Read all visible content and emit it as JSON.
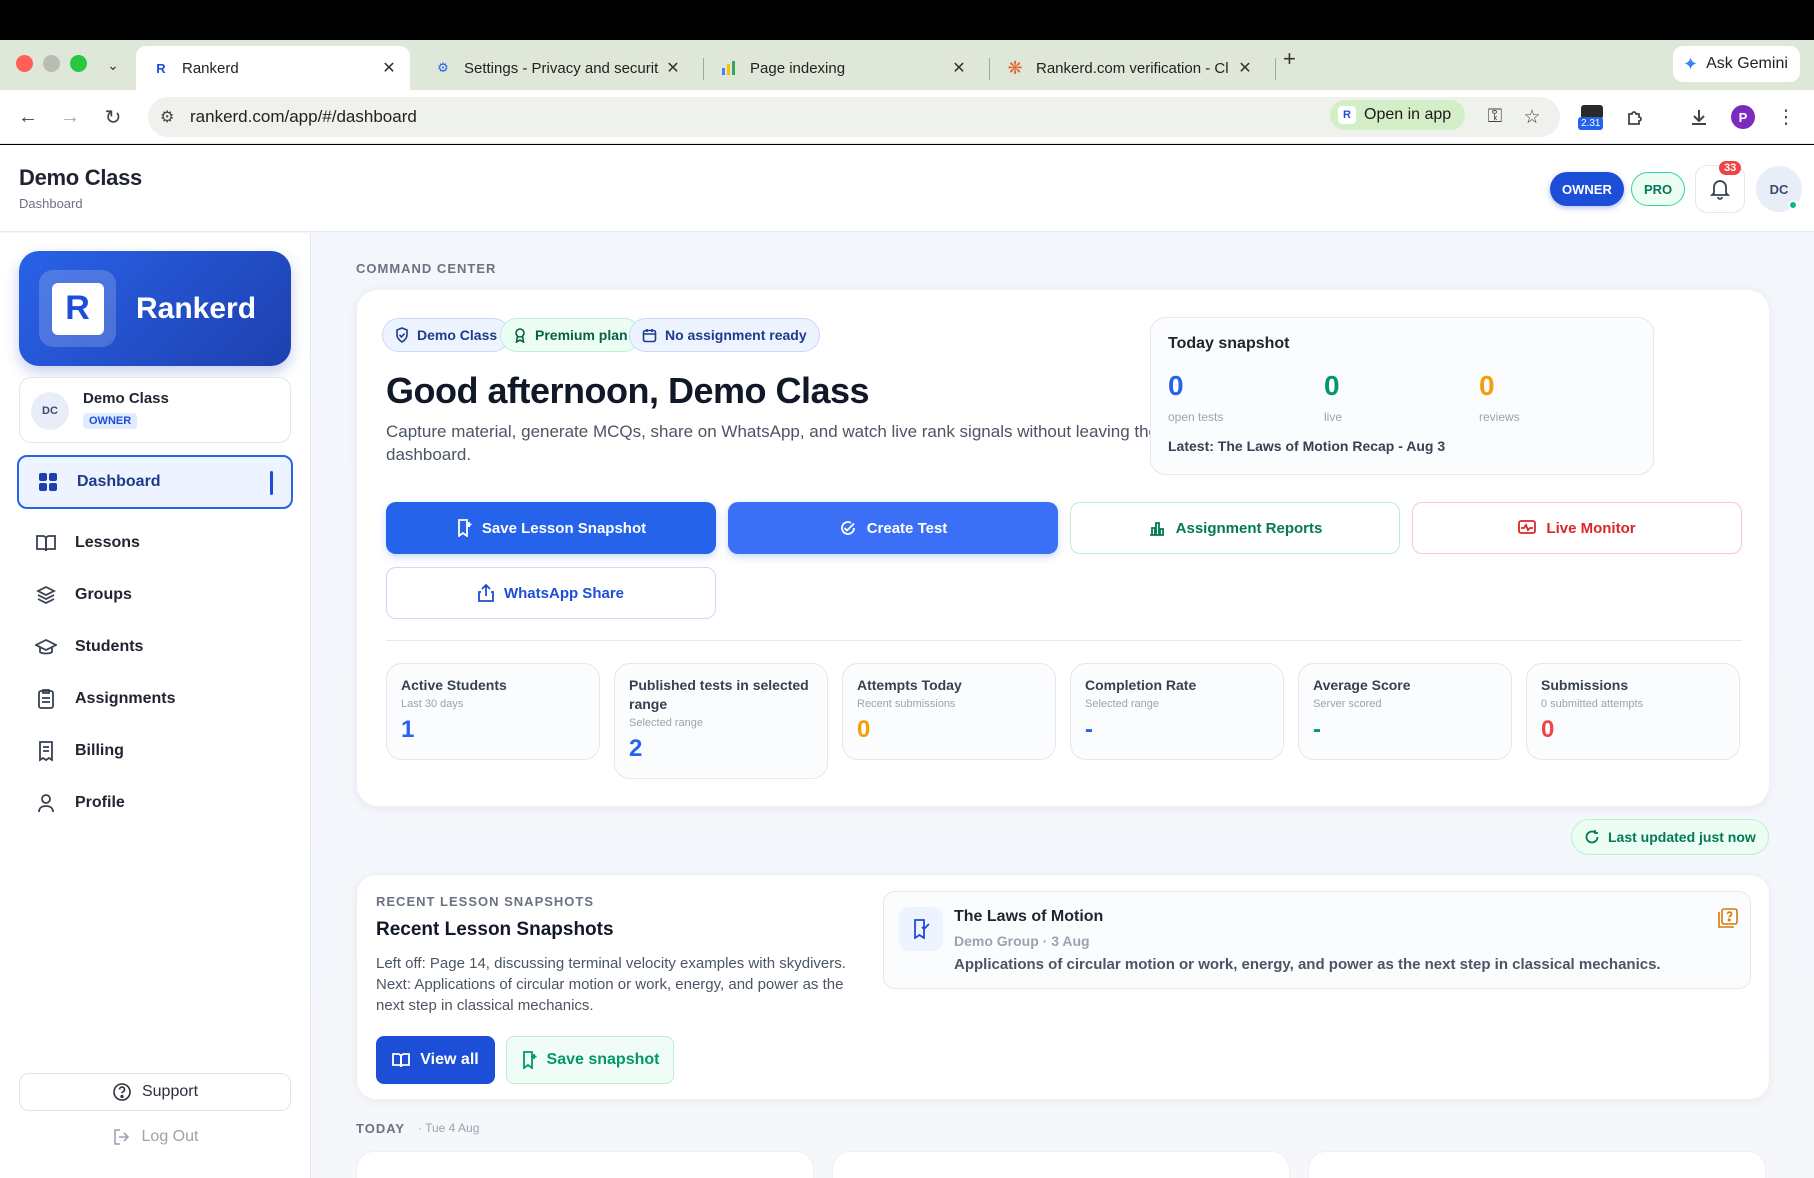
{
  "browser": {
    "tabs": [
      {
        "title": "Rankerd",
        "favicon": "rankerd-logo",
        "active": true
      },
      {
        "title": "Settings - Privacy and securit",
        "favicon": "gear-icon",
        "active": false
      },
      {
        "title": "Page indexing",
        "favicon": "search-console-icon",
        "active": false
      },
      {
        "title": "Rankerd.com verification - Cl",
        "favicon": "claude-icon",
        "active": false
      }
    ],
    "ask_gemini": "Ask Gemini",
    "url": "rankerd.com/app/#/dashboard",
    "open_in_app": "Open in app",
    "extension_badge": "2.31",
    "profile_initial": "P"
  },
  "header": {
    "title": "Demo Class",
    "subtitle": "Dashboard",
    "owner_pill": "OWNER",
    "pro_pill": "PRO",
    "notification_count": "33",
    "avatar_initials": "DC"
  },
  "sidebar": {
    "brand": "Rankerd",
    "brand_mark": "R",
    "org": {
      "initials": "DC",
      "name": "Demo Class",
      "role": "OWNER"
    },
    "items": [
      {
        "label": "Dashboard",
        "icon": "grid-icon",
        "active": true
      },
      {
        "label": "Lessons",
        "icon": "book-icon"
      },
      {
        "label": "Groups",
        "icon": "layers-icon"
      },
      {
        "label": "Students",
        "icon": "graduation-cap-icon"
      },
      {
        "label": "Assignments",
        "icon": "clipboard-icon"
      },
      {
        "label": "Billing",
        "icon": "receipt-icon"
      },
      {
        "label": "Profile",
        "icon": "user-icon"
      }
    ],
    "support": "Support",
    "logout": "Log Out"
  },
  "command_center": {
    "eyebrow": "COMMAND CENTER",
    "chips": [
      {
        "label": "Demo Class",
        "icon": "shield-check-icon",
        "tone": "blue"
      },
      {
        "label": "Premium plan",
        "icon": "award-icon",
        "tone": "green"
      },
      {
        "label": "No assignment ready",
        "icon": "calendar-icon",
        "tone": "blue"
      }
    ],
    "greeting": "Good afternoon, Demo Class",
    "description": "Capture material, generate MCQs, share on WhatsApp, and watch live rank signals without leaving the dashboard.",
    "snapshot": {
      "title": "Today snapshot",
      "metrics": [
        {
          "value": "0",
          "label": "open tests",
          "color": "#2563eb"
        },
        {
          "value": "0",
          "label": "live",
          "color": "#059669"
        },
        {
          "value": "0",
          "label": "reviews",
          "color": "#f59e0b"
        }
      ],
      "latest": "Latest: The Laws of Motion Recap - Aug 3"
    },
    "actions": [
      {
        "label": "Save Lesson Snapshot",
        "style": "solid"
      },
      {
        "label": "Create Test",
        "style": "solid2"
      },
      {
        "label": "Assignment Reports",
        "style": "green"
      },
      {
        "label": "Live Monitor",
        "style": "red"
      },
      {
        "label": "WhatsApp Share",
        "style": "blueout"
      }
    ],
    "stats": [
      {
        "label": "Active Students",
        "sub": "Last 30 days",
        "value": "1",
        "color": "#2563eb"
      },
      {
        "label": "Published tests in selected range",
        "sub": "Selected range",
        "value": "2",
        "color": "#2563eb"
      },
      {
        "label": "Attempts Today",
        "sub": "Recent submissions",
        "value": "0",
        "color": "#f59e0b"
      },
      {
        "label": "Completion Rate",
        "sub": "Selected range",
        "value": "-",
        "color": "#2563eb"
      },
      {
        "label": "Average Score",
        "sub": "Server scored",
        "value": "-",
        "color": "#059669"
      },
      {
        "label": "Submissions",
        "sub": "0 submitted attempts",
        "value": "0",
        "color": "#ef4444"
      }
    ],
    "last_updated": "Last updated just now"
  },
  "recent": {
    "eyebrow": "RECENT LESSON SNAPSHOTS",
    "title": "Recent Lesson Snapshots",
    "description": "Left off: Page 14, discussing terminal velocity examples with skydivers. Next: Applications of circular motion or work, energy, and power as the next step in classical mechanics.",
    "view_all": "View all",
    "save_snapshot": "Save snapshot",
    "item": {
      "title": "The Laws of Motion",
      "meta": "Demo Group · 3 Aug",
      "next": "Applications of circular motion or work, energy, and power as the next step in classical mechanics."
    }
  },
  "today": {
    "label": "TODAY",
    "date": "· Tue 4 Aug"
  }
}
